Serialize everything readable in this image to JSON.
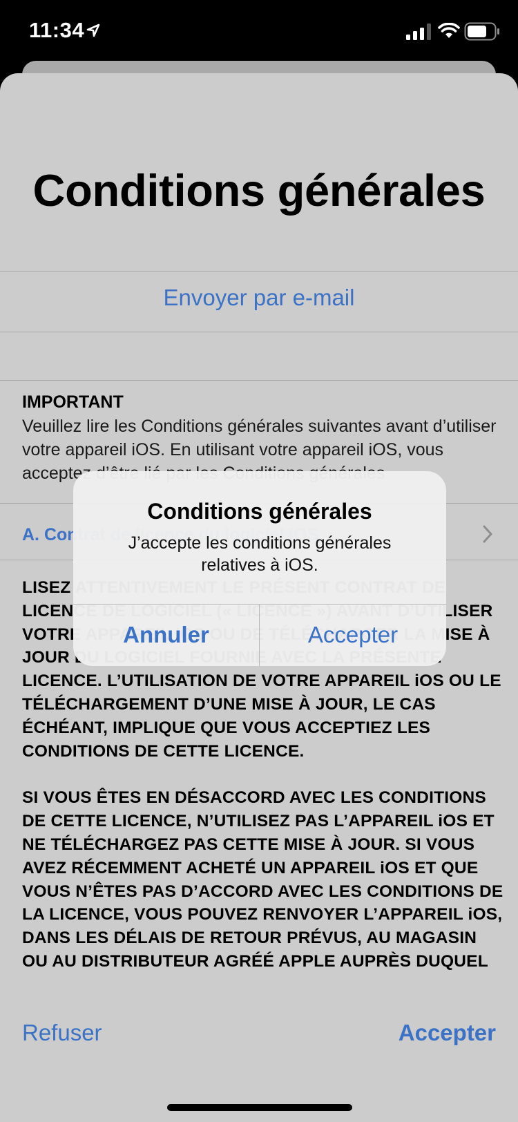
{
  "status_bar": {
    "time": "11:34",
    "icons": [
      "location-arrow-icon",
      "cellular-signal-icon",
      "wifi-icon",
      "battery-icon"
    ]
  },
  "title": "Conditions générales",
  "email_link": "Envoyer par e-mail",
  "important": {
    "heading": "IMPORTANT",
    "body": "Veuillez lire les Conditions générales suivantes avant d’utiliser votre appareil iOS. En utilisant votre appareil iOS, vous acceptez d’être lié par les Conditions générales"
  },
  "section_link": {
    "label": "A. Contrat de licence du logiciel iOS",
    "icon": "chevron-right-icon"
  },
  "license": {
    "paragraph1": "LISEZ ATTENTIVEMENT LE PRÉSENT CONTRAT DE LICENCE DE LOGICIEL (« LICENCE ») AVANT D’UTILISER VOTRE APPAREIL iOS OU DE TÉLÉCHARGER LA MISE À JOUR DU LOGICIEL FOURNIE AVEC LA PRÉSENTE LICENCE. L’UTILISATION DE VOTRE APPAREIL iOS OU LE TÉLÉCHARGEMENT D’UNE MISE À JOUR, LE CAS ÉCHÉANT, IMPLIQUE QUE VOUS ACCEPTIEZ LES CONDITIONS DE CETTE LICENCE.",
    "paragraph2": "SI VOUS ÊTES EN DÉSACCORD AVEC LES CONDITIONS DE CETTE LICENCE, N’UTILISEZ PAS L’APPAREIL iOS ET NE TÉLÉCHARGEZ PAS CETTE MISE À JOUR. SI VOUS AVEZ RÉCEMMENT ACHETÉ UN APPAREIL iOS ET QUE VOUS N’ÊTES PAS D’ACCORD AVEC LES CONDITIONS DE LA LICENCE, VOUS POUVEZ RENVOYER L’APPAREIL iOS, DANS LES DÉLAIS DE RETOUR PRÉVUS, AU MAGASIN OU AU DISTRIBUTEUR AGRÉÉ APPLE AUPRÈS DUQUEL"
  },
  "footer": {
    "refuse_label": "Refuser",
    "accept_label": "Accepter"
  },
  "alert": {
    "title": "Conditions générales",
    "message": "J’accepte les conditions générales relatives à iOS.",
    "cancel_label": "Annuler",
    "accept_label": "Accepter"
  },
  "colors": {
    "accent": "#3b72c6",
    "sheet_background": "#cccccc",
    "alert_background": "#eeeeee"
  }
}
